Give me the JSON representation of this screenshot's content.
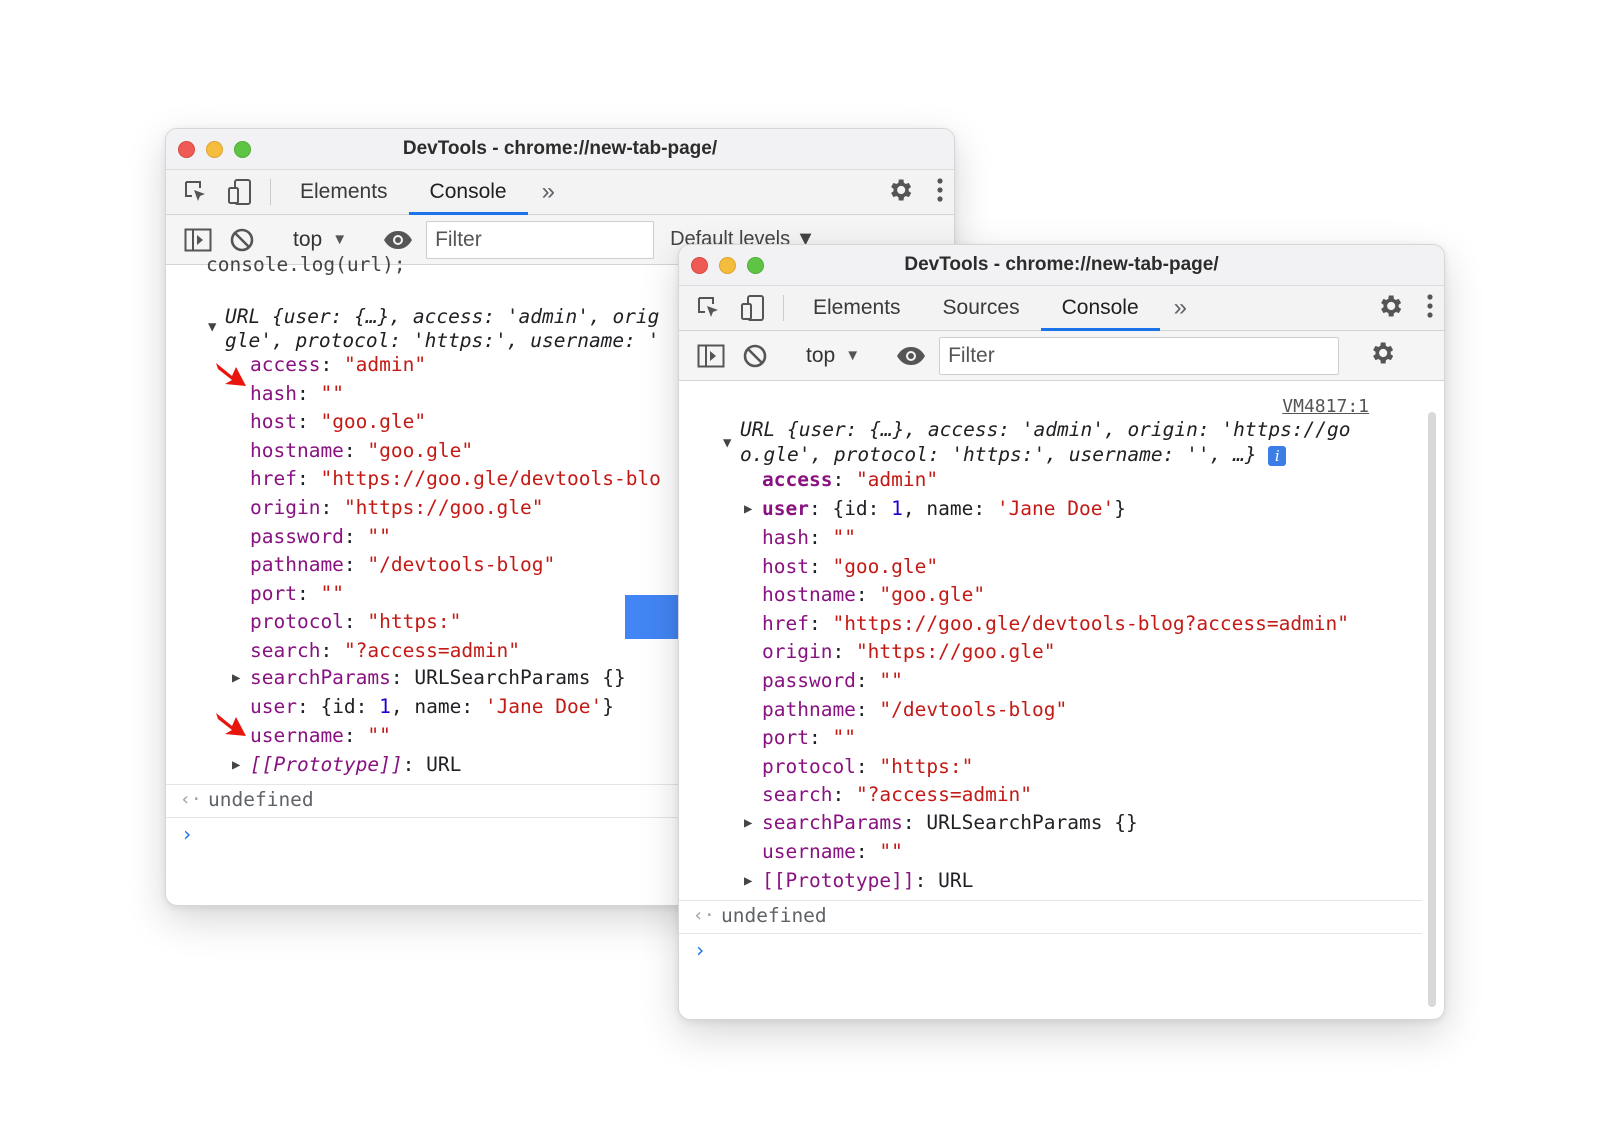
{
  "back_window": {
    "title": "DevTools - chrome://new-tab-page/",
    "tabs": {
      "elements": "Elements",
      "console": "Console"
    },
    "toolbar": {
      "context": "top",
      "filter_placeholder": "Filter",
      "levels": "Default levels"
    },
    "clipped_command": "console.log(url);",
    "object_summary": {
      "lead": "URL",
      "line1_rest": "{user: {…}, access: 'admin', orig",
      "line2": "gle', protocol: 'https:', username: '"
    },
    "props": [
      {
        "key": "access",
        "val": "\"admin\""
      },
      {
        "key": "hash",
        "val": "\"\""
      },
      {
        "key": "host",
        "val": "\"goo.gle\""
      },
      {
        "key": "hostname",
        "val": "\"goo.gle\""
      },
      {
        "key": "href",
        "val": "\"https://goo.gle/devtools-blo"
      },
      {
        "key": "origin",
        "val": "\"https://goo.gle\""
      },
      {
        "key": "password",
        "val": "\"\""
      },
      {
        "key": "pathname",
        "val": "\"/devtools-blog\""
      },
      {
        "key": "port",
        "val": "\"\""
      },
      {
        "key": "protocol",
        "val": "\"https:\""
      },
      {
        "key": "search",
        "val": "\"?access=admin\""
      }
    ],
    "search_params": {
      "key": "searchParams",
      "val": "URLSearchParams {}"
    },
    "user": {
      "key": "user",
      "open": "{id: ",
      "id": "1",
      "mid": ", name: ",
      "name": "'Jane Doe'",
      "close": "}"
    },
    "username": {
      "key": "username",
      "val": "\"\""
    },
    "prototype": {
      "key": "[[Prototype]]",
      "val": "URL"
    },
    "result": "undefined",
    "prompt": "›"
  },
  "front_window": {
    "title": "DevTools - chrome://new-tab-page/",
    "tabs": {
      "elements": "Elements",
      "sources": "Sources",
      "console": "Console"
    },
    "toolbar": {
      "context": "top",
      "filter_placeholder": "Filter"
    },
    "source_link": "VM4817:1",
    "object_summary": {
      "lead": "URL",
      "line1_rest": "{user: {…}, access: 'admin', origin: 'https://go",
      "line2": "o.gle', protocol: 'https:', username: '', …}",
      "info": "i"
    },
    "access": {
      "key": "access",
      "val": "\"admin\""
    },
    "user": {
      "key": "user",
      "open": "{id: ",
      "id": "1",
      "mid": ", name: ",
      "name": "'Jane Doe'",
      "close": "}"
    },
    "props": [
      {
        "key": "hash",
        "val": "\"\""
      },
      {
        "key": "host",
        "val": "\"goo.gle\""
      },
      {
        "key": "hostname",
        "val": "\"goo.gle\""
      },
      {
        "key": "href",
        "val": "\"https://goo.gle/devtools-blog?access=admin\""
      },
      {
        "key": "origin",
        "val": "\"https://goo.gle\""
      },
      {
        "key": "password",
        "val": "\"\""
      },
      {
        "key": "pathname",
        "val": "\"/devtools-blog\""
      },
      {
        "key": "port",
        "val": "\"\""
      },
      {
        "key": "protocol",
        "val": "\"https:\""
      },
      {
        "key": "search",
        "val": "\"?access=admin\""
      }
    ],
    "search_params": {
      "key": "searchParams",
      "val": "URLSearchParams {}"
    },
    "username": {
      "key": "username",
      "val": "\"\""
    },
    "prototype": {
      "key": "[[Prototype]]",
      "val": "URL"
    },
    "result": "undefined",
    "prompt": "›"
  },
  "colors": {
    "transition_arrow": "#4285f4",
    "annotation_arrow": "#e8150c",
    "property_key": "#881280",
    "string_value": "#c41a16",
    "number_value": "#1c00cf",
    "active_tab_underline": "#1a73e8"
  }
}
